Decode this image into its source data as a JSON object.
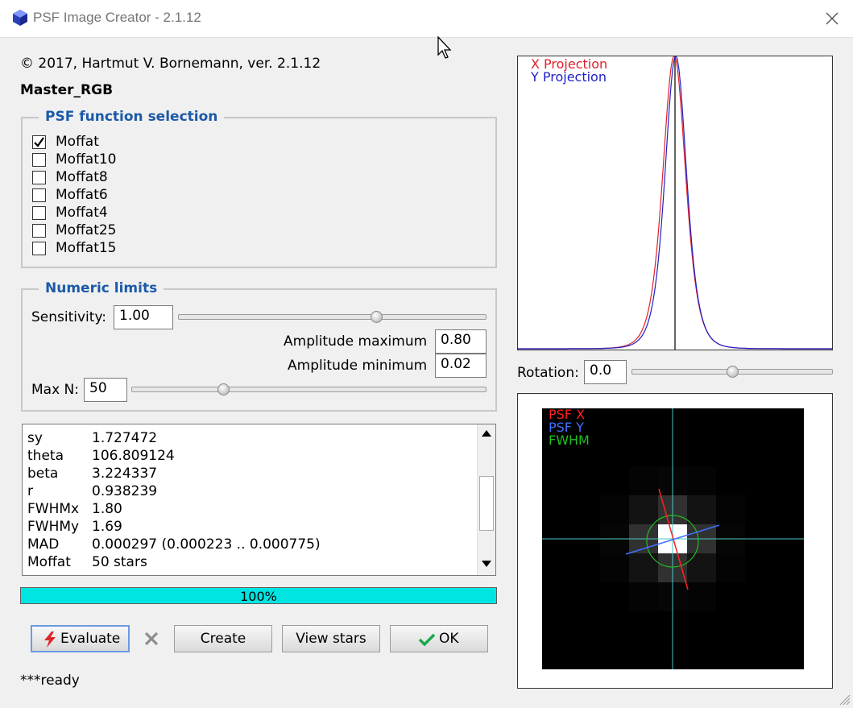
{
  "window": {
    "title": "PSF Image Creator - 2.1.12"
  },
  "header": {
    "copyright": "© 2017, Hartmut V. Bornemann, ver. 2.1.12",
    "image_name": "Master_RGB"
  },
  "psf_selection": {
    "legend": "PSF function selection",
    "options": [
      {
        "label": "Moffat",
        "checked": true
      },
      {
        "label": "Moffat10",
        "checked": false
      },
      {
        "label": "Moffat8",
        "checked": false
      },
      {
        "label": "Moffat6",
        "checked": false
      },
      {
        "label": "Moffat4",
        "checked": false
      },
      {
        "label": "Moffat25",
        "checked": false
      },
      {
        "label": "Moffat15",
        "checked": false
      }
    ]
  },
  "numeric_limits": {
    "legend": "Numeric limits",
    "sensitivity_label": "Sensitivity:",
    "sensitivity_value": "1.00",
    "sensitivity_slider": 0.65,
    "amp_max_label": "Amplitude maximum",
    "amp_max_value": "0.80",
    "amp_min_label": "Amplitude minimum",
    "amp_min_value": "0.02",
    "maxn_label": "Max N:",
    "maxn_value": "50",
    "maxn_slider": 0.25
  },
  "results": [
    {
      "key": "sy",
      "value": "1.727472"
    },
    {
      "key": "theta",
      "value": "106.809124"
    },
    {
      "key": "beta",
      "value": "3.224337"
    },
    {
      "key": "r",
      "value": "0.938239"
    },
    {
      "key": "FWHMx",
      "value": "1.80"
    },
    {
      "key": "FWHMy",
      "value": "1.69"
    },
    {
      "key": "MAD",
      "value": "0.000297 (0.000223 .. 0.000775)"
    },
    {
      "key": "Moffat",
      "value": "50 stars"
    }
  ],
  "progress": {
    "percent": 100,
    "label": "100%"
  },
  "buttons": {
    "evaluate": "Evaluate",
    "create": "Create",
    "view_stars": "View stars",
    "ok": "OK"
  },
  "status": "***ready",
  "projection_plot": {
    "legend_x": "X Projection",
    "legend_y": "Y Projection",
    "color_x": "#e0202a",
    "color_y": "#2020c8"
  },
  "rotation": {
    "label": "Rotation:",
    "value": "0.0",
    "slider": 0.5
  },
  "psf_image": {
    "legend_x": "PSF X",
    "legend_y": "PSF Y",
    "legend_fwhm": "FWHM",
    "color_x": "#ff2020",
    "color_y": "#4070ff",
    "color_fwhm": "#20c020"
  },
  "colors": {
    "legend_text": "#1c5aa8",
    "progress_fill": "#00e5e2",
    "evaluate_border": "#6a9be0"
  },
  "icons": {
    "app": "blue-cube-icon",
    "close": "close-icon",
    "evaluate": "lightning-icon",
    "cancel": "x-icon",
    "ok": "checkmark-icon"
  }
}
